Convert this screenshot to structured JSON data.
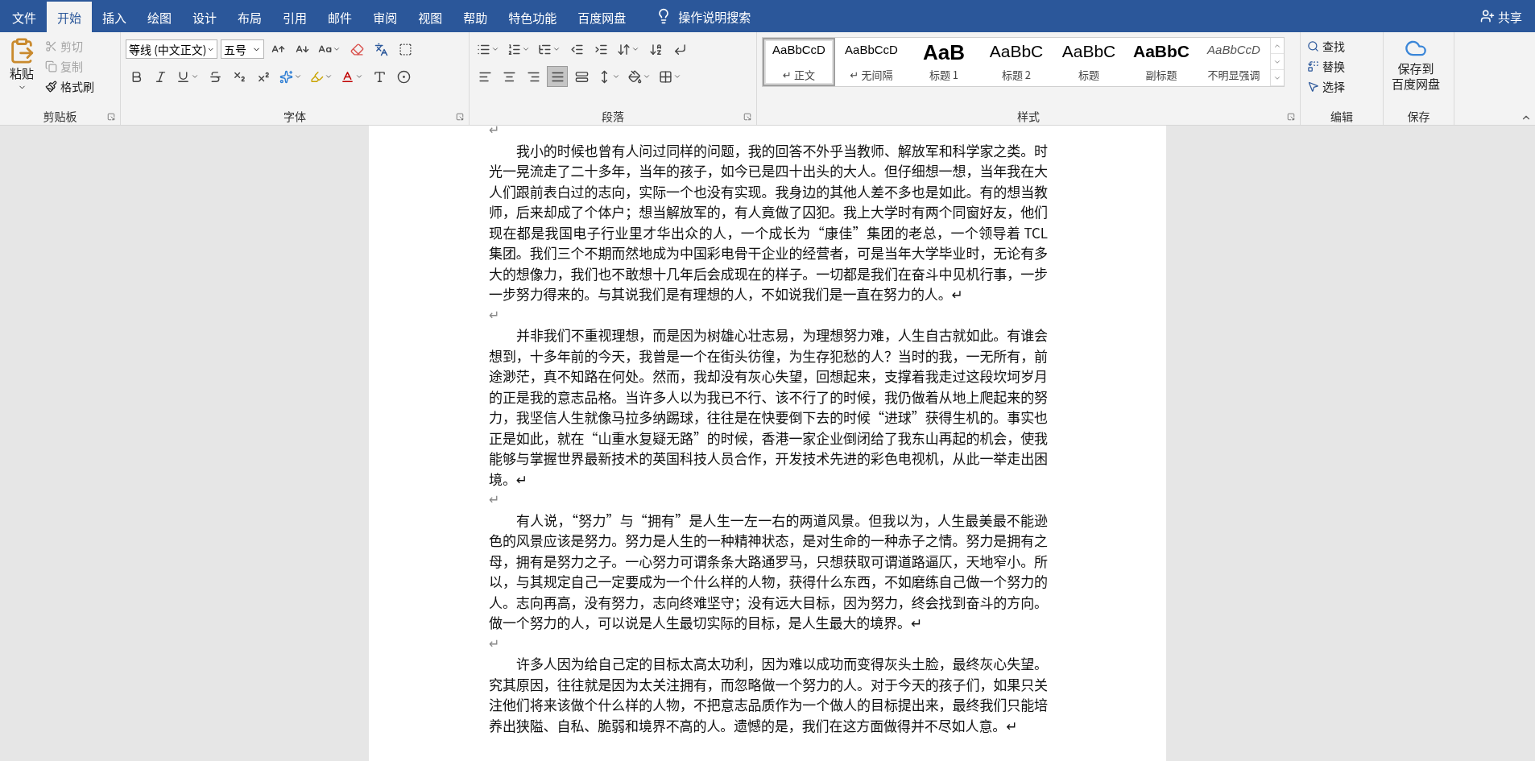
{
  "ribbon_tabs": [
    {
      "label": "文件",
      "selected": false
    },
    {
      "label": "开始",
      "selected": true
    },
    {
      "label": "插入",
      "selected": false
    },
    {
      "label": "绘图",
      "selected": false
    },
    {
      "label": "设计",
      "selected": false
    },
    {
      "label": "布局",
      "selected": false
    },
    {
      "label": "引用",
      "selected": false
    },
    {
      "label": "邮件",
      "selected": false
    },
    {
      "label": "审阅",
      "selected": false
    },
    {
      "label": "视图",
      "selected": false
    },
    {
      "label": "帮助",
      "selected": false
    },
    {
      "label": "特色功能",
      "selected": false
    },
    {
      "label": "百度网盘",
      "selected": false
    }
  ],
  "search_hint": "操作说明搜索",
  "share": "共享",
  "clipboard": {
    "group": "剪贴板",
    "paste": "粘贴",
    "items": [
      {
        "label": "剪切",
        "kind": "cut",
        "disabled": true
      },
      {
        "label": "复制",
        "kind": "copy",
        "disabled": true
      },
      {
        "label": "格式刷",
        "kind": "painter",
        "disabled": false
      }
    ]
  },
  "font": {
    "group": "字体",
    "family": "等线 (中文正文)",
    "size": "五号"
  },
  "paragraph": {
    "group": "段落",
    "alignments": [
      {
        "kind": "left",
        "selected": false
      },
      {
        "kind": "center",
        "selected": false
      },
      {
        "kind": "right",
        "selected": false
      },
      {
        "kind": "justify",
        "selected": true
      },
      {
        "kind": "distributed",
        "selected": false
      }
    ]
  },
  "styles": {
    "group": "样式",
    "items": [
      {
        "preview": "AaBbCcD",
        "label": "↵ 正文",
        "kind": "normal",
        "selected": true
      },
      {
        "preview": "AaBbCcD",
        "label": "↵ 无间隔",
        "kind": "normal",
        "selected": false
      },
      {
        "preview": "AaB",
        "label": "标题 1",
        "kind": "heading1",
        "selected": false
      },
      {
        "preview": "AaBbC",
        "label": "标题 2",
        "kind": "heading2",
        "selected": false
      },
      {
        "preview": "AaBbC",
        "label": "标题",
        "kind": "title",
        "selected": false
      },
      {
        "preview": "AaBbC",
        "label": "副标题",
        "kind": "subtitle",
        "selected": false
      },
      {
        "preview": "AaBbCcD",
        "label": "不明显强调",
        "kind": "emphasis",
        "selected": false
      }
    ]
  },
  "editing": {
    "group": "编辑",
    "items": [
      {
        "label": "查找",
        "kind": "find"
      },
      {
        "label": "替换",
        "kind": "replace"
      },
      {
        "label": "选择",
        "kind": "select"
      }
    ]
  },
  "save": {
    "group": "保存",
    "lines": [
      "保存到",
      "百度网盘"
    ]
  },
  "document": {
    "paragraphs": [
      {
        "text": "↵",
        "indent": false
      },
      {
        "text": "我小的时候也曾有人问过同样的问题，我的回答不外乎当教师、解放军和科学家之类。时光一晃流走了二十多年，当年的孩子，如今已是四十出头的大人。但仔细想一想，当年我在大人们跟前表白过的志向，实际一个也没有实现。我身边的其他人差不多也是如此。有的想当教师，后来却成了个体户；想当解放军的，有人竟做了囚犯。我上大学时有两个同窗好友，他们现在都是我国电子行业里才华出众的人，一个成长为“康佳”集团的老总，一个领导着 TCL 集团。我们三个不期而然地成为中国彩电骨干企业的经营者，可是当年大学毕业时，无论有多大的想像力，我们也不敢想十几年后会成现在的样子。一切都是我们在奋斗中见机行事，一步一步努力得来的。与其说我们是有理想的人，不如说我们是一直在努力的人。↵",
        "indent": true
      },
      {
        "text": "↵",
        "indent": false
      },
      {
        "text": "并非我们不重视理想，而是因为树雄心壮志易，为理想努力难，人生自古就如此。有谁会想到，十多年前的今天，我曾是一个在街头彷徨，为生存犯愁的人？当时的我，一无所有，前途渺茫，真不知路在何处。然而，我却没有灰心失望，回想起来，支撑着我走过这段坎坷岁月的正是我的意志品格。当许多人以为我已不行、该不行了的时候，我仍做着从地上爬起来的努力，我坚信人生就像马拉多纳踢球，往往是在快要倒下去的时候“进球”获得生机的。事实也正是如此，就在“山重水复疑无路”的时候，香港一家企业倒闭给了我东山再起的机会，使我能够与掌握世界最新技术的英国科技人员合作，开发技术先进的彩色电视机，从此一举走出困境。↵",
        "indent": true
      },
      {
        "text": "↵",
        "indent": false
      },
      {
        "text": "有人说，“努力”与“拥有”是人生一左一右的两道风景。但我以为，人生最美最不能逊色的风景应该是努力。努力是人生的一种精神状态，是对生命的一种赤子之情。努力是拥有之母，拥有是努力之子。一心努力可谓条条大路通罗马，只想获取可谓道路逼仄，天地窄小。所以，与其规定自己一定要成为一个什么样的人物，获得什么东西，不如磨练自己做一个努力的人。志向再高，没有努力，志向终难坚守；没有远大目标，因为努力，终会找到奋斗的方向。做一个努力的人，可以说是人生最切实际的目标，是人生最大的境界。↵",
        "indent": true
      },
      {
        "text": "↵",
        "indent": false
      },
      {
        "text": "许多人因为给自己定的目标太高太功利，因为难以成功而变得灰头土脸，最终灰心失望。究其原因，往往就是因为太关注拥有，而忽略做一个努力的人。对于今天的孩子们，如果只关注他们将来该做个什么样的人物，不把意志品质作为一个做人的目标提出来，最终我们只能培养出狭隘、自私、脆弱和境界不高的人。遗憾的是，我们在这方面做得并不尽如人意。↵",
        "indent": true
      }
    ]
  }
}
